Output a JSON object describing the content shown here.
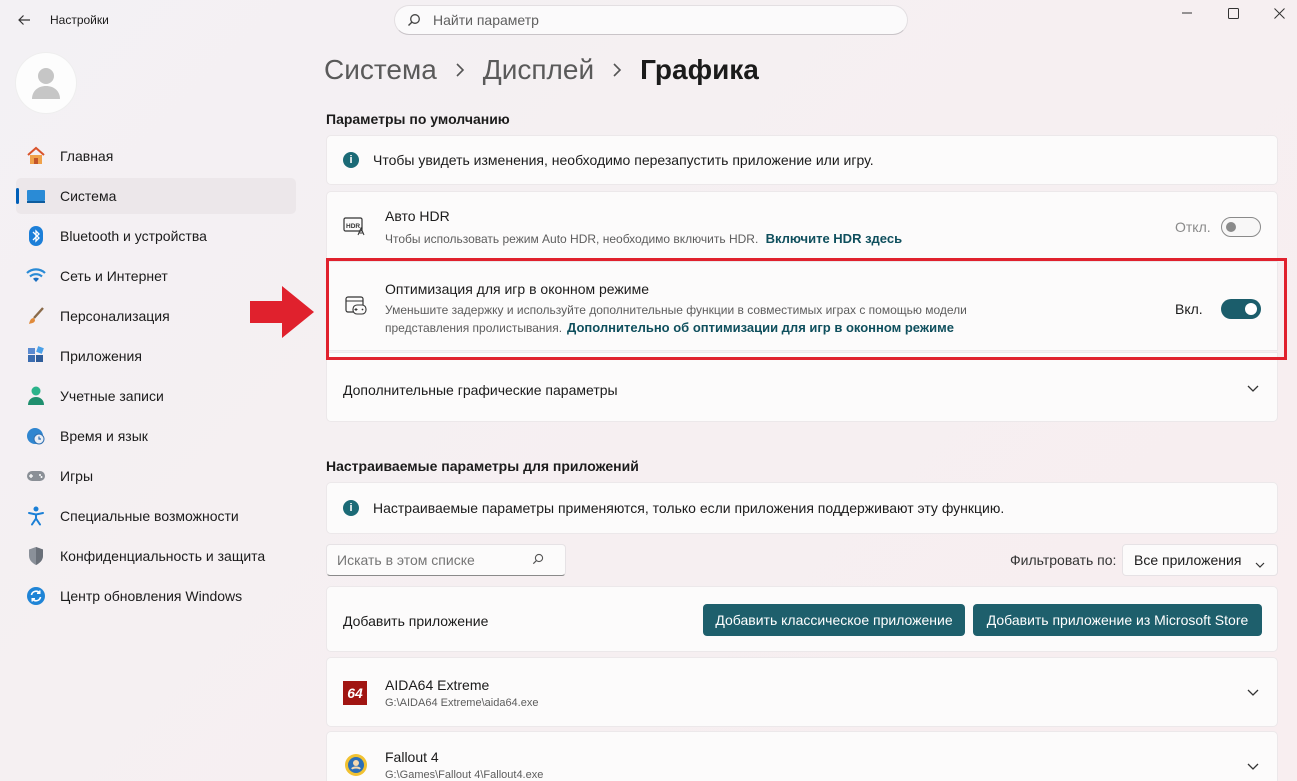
{
  "titlebar": {
    "back_icon": "arrow-left-icon",
    "app_title": "Настройки",
    "search_placeholder": "Найти параметр",
    "controls": [
      "minimize-icon",
      "maximize-icon",
      "close-icon"
    ]
  },
  "sidebar": {
    "items": [
      {
        "label": "Главная",
        "icon": "home-icon",
        "active": false
      },
      {
        "label": "Система",
        "icon": "system-display-icon",
        "active": true
      },
      {
        "label": "Bluetooth и устройства",
        "icon": "bluetooth-icon",
        "active": false
      },
      {
        "label": "Сеть и Интернет",
        "icon": "wifi-icon",
        "active": false
      },
      {
        "label": "Персонализация",
        "icon": "brush-icon",
        "active": false
      },
      {
        "label": "Приложения",
        "icon": "apps-icon",
        "active": false
      },
      {
        "label": "Учетные записи",
        "icon": "user-icon",
        "active": false
      },
      {
        "label": "Время и язык",
        "icon": "clock-globe-icon",
        "active": false
      },
      {
        "label": "Игры",
        "icon": "gamepad-icon",
        "active": false
      },
      {
        "label": "Специальные возможности",
        "icon": "accessibility-icon",
        "active": false
      },
      {
        "label": "Конфиденциальность и защита",
        "icon": "shield-icon",
        "active": false
      },
      {
        "label": "Центр обновления Windows",
        "icon": "update-icon",
        "active": false
      }
    ]
  },
  "breadcrumb": {
    "items": [
      "Система",
      "Дисплей",
      "Графика"
    ]
  },
  "defaults": {
    "heading": "Параметры по умолчанию",
    "info_text": "Чтобы увидеть изменения, необходимо перезапустить приложение или игру.",
    "auto_hdr": {
      "title": "Авто HDR",
      "desc": "Чтобы использовать режим Auto HDR, необходимо включить HDR.",
      "link": "Включите HDR здесь",
      "state_label": "Откл.",
      "enabled": false
    },
    "windowed": {
      "title": "Оптимизация для игр в оконном режиме",
      "desc_line1": "Уменьшите задержку и используйте дополнительные функции в совместимых играх с помощью модели",
      "desc_line2": "представления пролистывания.",
      "link": "Дополнительно об оптимизации для игр в оконном режиме",
      "state_label": "Вкл.",
      "enabled": true
    },
    "advanced": {
      "label": "Дополнительные графические параметры"
    }
  },
  "custom": {
    "heading": "Настраиваемые параметры для приложений",
    "info_text": "Настраиваемые параметры применяются, только если приложения поддерживают эту функцию.",
    "search_placeholder": "Искать в этом списке",
    "filter_label": "Фильтровать по:",
    "filter_value": "Все приложения",
    "add_label": "Добавить приложение",
    "add_classic": "Добавить классическое приложение",
    "add_store": "Добавить приложение из Microsoft Store",
    "apps": [
      {
        "name": "AIDA64 Extreme",
        "path": "G:\\AIDA64 Extreme\\aida64.exe",
        "icon_text": "64"
      },
      {
        "name": "Fallout 4",
        "path": "G:\\Games\\Fallout 4\\Fallout4.exe",
        "icon_text": ""
      }
    ]
  },
  "annotation": {
    "arrow_color": "#e0212d",
    "box_color": "#e0212d"
  }
}
